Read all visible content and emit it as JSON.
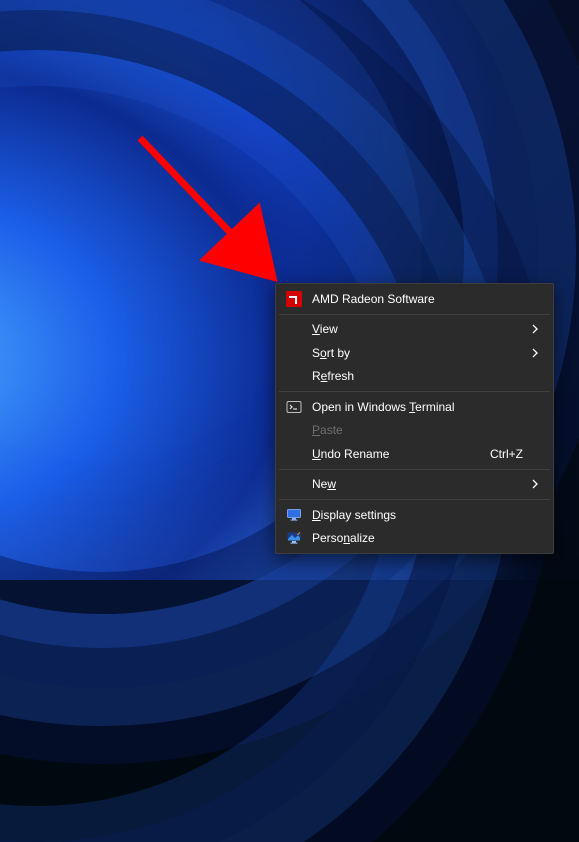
{
  "context_menu": {
    "items": {
      "amd": {
        "label": "AMD Radeon Software"
      },
      "view": {
        "label_pre": "",
        "accel": "V",
        "label_post": "iew"
      },
      "sort_by": {
        "label_pre": "S",
        "accel": "o",
        "label_post": "rt by"
      },
      "refresh": {
        "label_pre": "R",
        "accel": "e",
        "label_post": "fresh"
      },
      "open_terminal": {
        "label_pre": "Open in Windows ",
        "accel": "T",
        "label_post": "erminal"
      },
      "paste": {
        "label_pre": "",
        "accel": "P",
        "label_post": "aste"
      },
      "undo_rename": {
        "label_pre": "",
        "accel": "U",
        "label_post": "ndo Rename",
        "shortcut": "Ctrl+Z"
      },
      "new": {
        "label_pre": "Ne",
        "accel": "w",
        "label_post": ""
      },
      "display_settings": {
        "label_pre": "",
        "accel": "D",
        "label_post": "isplay settings"
      },
      "personalize": {
        "label_pre": "Perso",
        "accel": "n",
        "label_post": "alize"
      }
    }
  }
}
